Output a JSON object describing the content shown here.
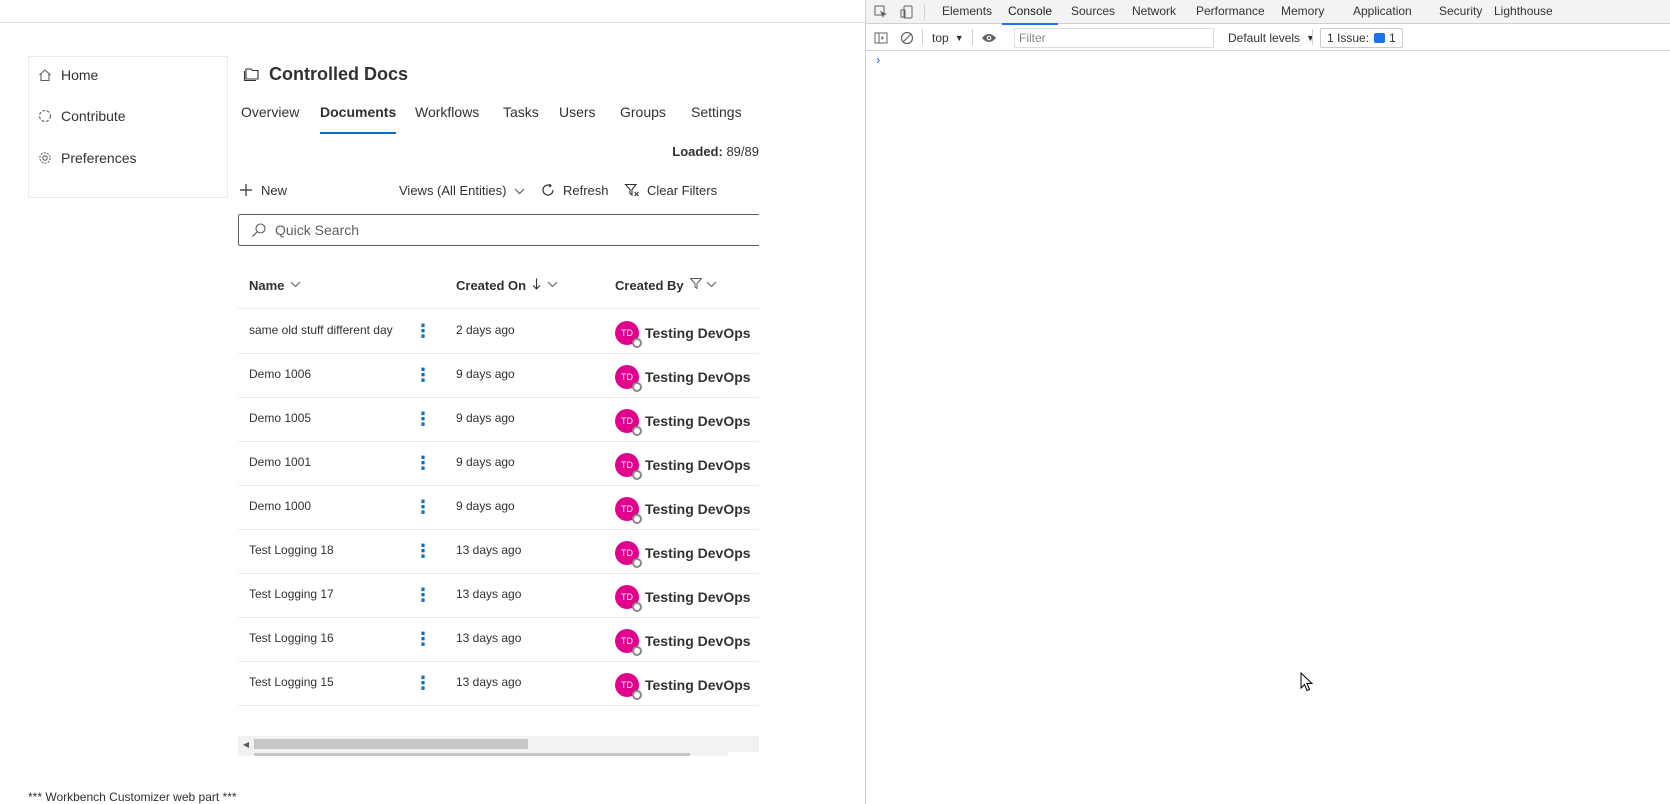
{
  "nav": {
    "items": [
      {
        "label": "Home",
        "icon": "home-icon"
      },
      {
        "label": "Contribute",
        "icon": "contribute-icon"
      },
      {
        "label": "Preferences",
        "icon": "gear-icon"
      }
    ]
  },
  "header": {
    "title": "Controlled Docs"
  },
  "tabs": [
    {
      "label": "Overview"
    },
    {
      "label": "Documents"
    },
    {
      "label": "Workflows"
    },
    {
      "label": "Tasks"
    },
    {
      "label": "Users"
    },
    {
      "label": "Groups"
    },
    {
      "label": "Settings"
    }
  ],
  "status": {
    "loaded_label": "Loaded:",
    "loaded_value": "89/89"
  },
  "toolbar": {
    "new_label": "New",
    "views_label": "Views (All Entities)",
    "refresh_label": "Refresh",
    "clear_filters_label": "Clear Filters"
  },
  "search": {
    "placeholder": "Quick Search"
  },
  "grid": {
    "columns": {
      "name": "Name",
      "created_on": "Created On",
      "created_by": "Created By"
    },
    "rows": [
      {
        "name": "same old stuff different day",
        "created_on": "2 days ago",
        "initials": "TD",
        "created_by": "Testing DevOps"
      },
      {
        "name": "Demo 1006",
        "created_on": "9 days ago",
        "initials": "TD",
        "created_by": "Testing DevOps"
      },
      {
        "name": "Demo 1005",
        "created_on": "9 days ago",
        "initials": "TD",
        "created_by": "Testing DevOps"
      },
      {
        "name": "Demo 1001",
        "created_on": "9 days ago",
        "initials": "TD",
        "created_by": "Testing DevOps"
      },
      {
        "name": "Demo 1000",
        "created_on": "9 days ago",
        "initials": "TD",
        "created_by": "Testing DevOps"
      },
      {
        "name": "Test Logging 18",
        "created_on": "13 days ago",
        "initials": "TD",
        "created_by": "Testing DevOps"
      },
      {
        "name": "Test Logging 17",
        "created_on": "13 days ago",
        "initials": "TD",
        "created_by": "Testing DevOps"
      },
      {
        "name": "Test Logging 16",
        "created_on": "13 days ago",
        "initials": "TD",
        "created_by": "Testing DevOps"
      },
      {
        "name": "Test Logging 15",
        "created_on": "13 days ago",
        "initials": "TD",
        "created_by": "Testing DevOps"
      }
    ]
  },
  "footer": {
    "text": "*** Workbench Customizer web part ***"
  },
  "devtools": {
    "tabs": [
      "Elements",
      "Console",
      "Sources",
      "Network",
      "Performance",
      "Memory",
      "Application",
      "Security",
      "Lighthouse"
    ],
    "active_tab": "Console",
    "context": "top",
    "filter_placeholder": "Filter",
    "levels": "Default levels",
    "issues_label": "1 Issue:",
    "issues_count": "1",
    "prompt": "›"
  },
  "colors": {
    "accent": "#0f6cbd",
    "avatar": "#e3008c",
    "devtools_accent": "#1a73e8"
  }
}
